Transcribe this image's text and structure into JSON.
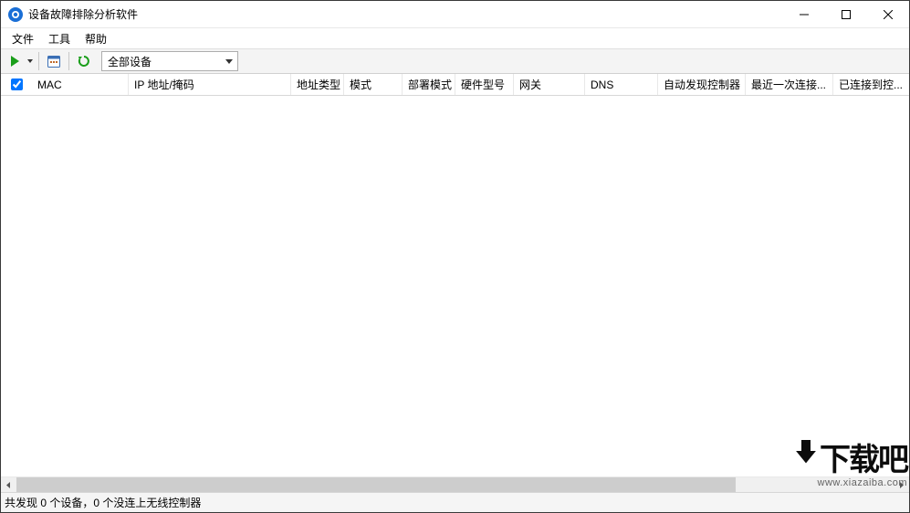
{
  "window": {
    "title": "设备故障排除分析软件"
  },
  "menu": {
    "file": "文件",
    "tools": "工具",
    "help": "帮助"
  },
  "toolbar": {
    "filter_label": "全部设备"
  },
  "columns": {
    "mac": "MAC",
    "ip_mask": "IP 地址/掩码",
    "addr_type": "地址类型",
    "mode": "模式",
    "deploy_mode": "部署模式",
    "hw_model": "硬件型号",
    "gateway": "网关",
    "dns": "DNS",
    "auto_controller": "自动发现控制器",
    "last_conn": "最近一次连接...",
    "connected_ctrl": "已连接到控..."
  },
  "status": {
    "text": "共发现 0 个设备，0 个没连上无线控制器"
  },
  "watermark": {
    "cn": "下载吧",
    "url": "www.xiazaiba.com"
  }
}
